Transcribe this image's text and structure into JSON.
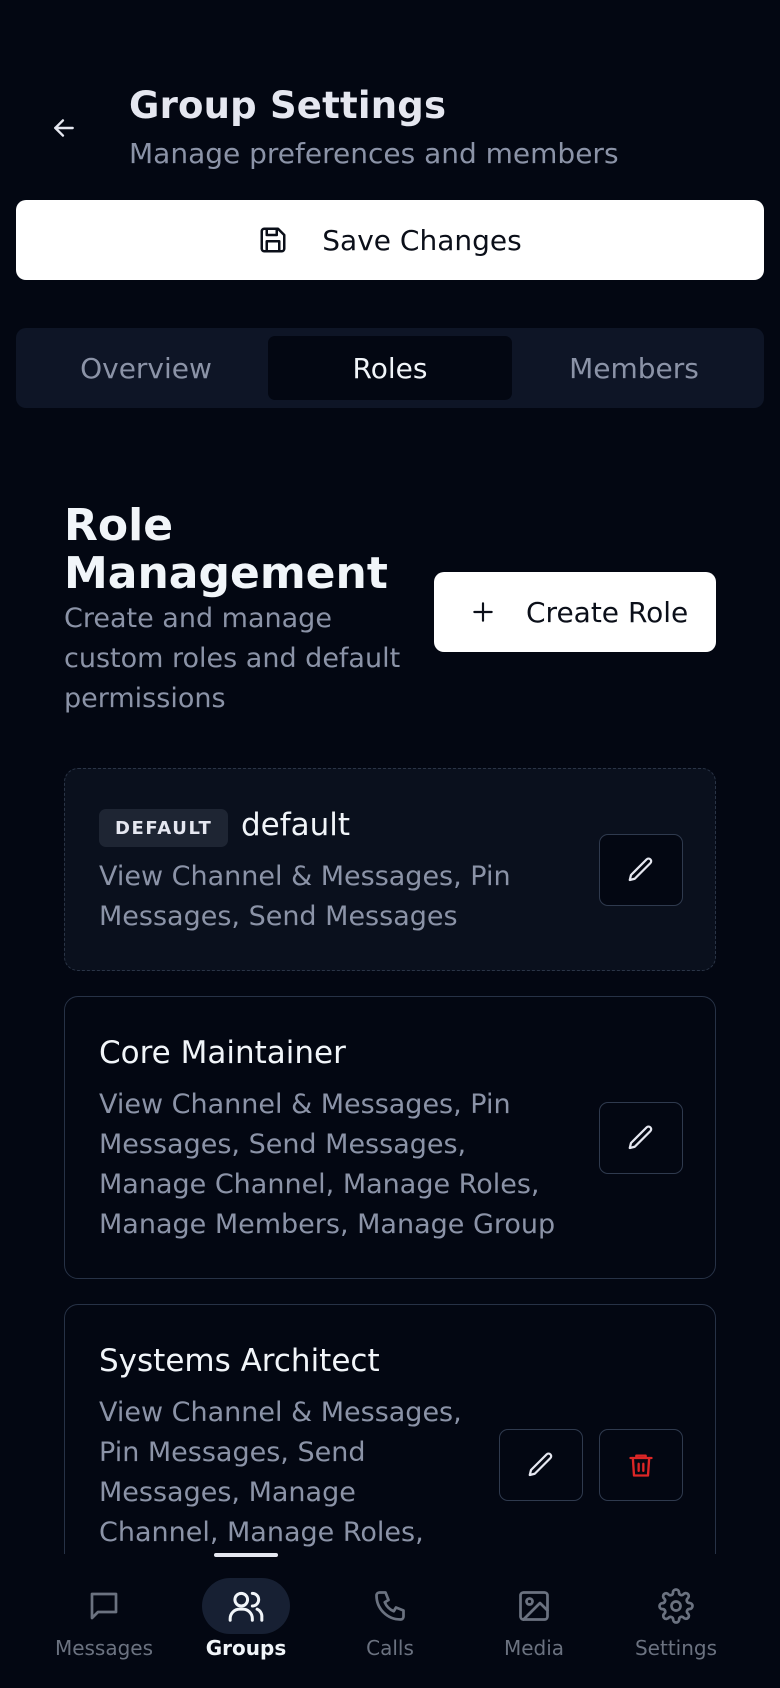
{
  "header": {
    "title": "Group Settings",
    "subtitle": "Manage preferences and members"
  },
  "save_button": {
    "label": "Save Changes"
  },
  "tabs": [
    {
      "label": "Overview",
      "active": false
    },
    {
      "label": "Roles",
      "active": true
    },
    {
      "label": "Members",
      "active": false
    }
  ],
  "section": {
    "title": "Role Management",
    "description": "Create and manage custom roles and default permissions",
    "create_button": "Create Role"
  },
  "roles": [
    {
      "badge": "DEFAULT",
      "name": "default",
      "permissions": "View Channel & Messages, Pin Messages, Send Messages"
    },
    {
      "name": "Core Maintainer",
      "permissions": "View Channel & Messages, Pin Messages, Send Messages, Manage Channel, Manage Roles, Manage Members, Manage Group"
    },
    {
      "name": "Systems Architect",
      "permissions": "View Channel & Messages, Pin Messages, Send Messages, Manage Channel, Manage Roles,"
    }
  ],
  "nav": [
    {
      "label": "Messages",
      "icon": "message-icon",
      "active": false
    },
    {
      "label": "Groups",
      "icon": "users-icon",
      "active": true
    },
    {
      "label": "Calls",
      "icon": "phone-icon",
      "active": false
    },
    {
      "label": "Media",
      "icon": "image-icon",
      "active": false
    },
    {
      "label": "Settings",
      "icon": "gear-icon",
      "active": false
    }
  ],
  "colors": {
    "background": "#030712",
    "surface": "#0e1526",
    "border": "#273246",
    "muted_text": "#8b93a7",
    "danger": "#dc2626"
  }
}
